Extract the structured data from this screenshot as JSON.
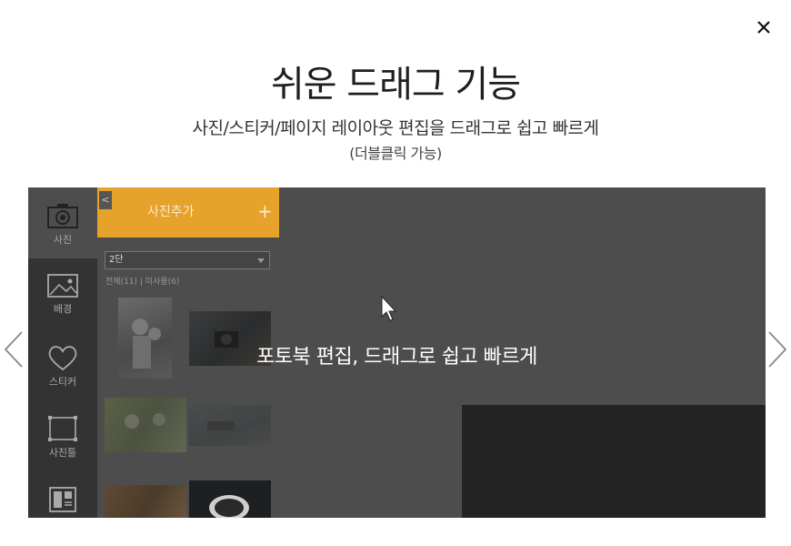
{
  "dialog": {
    "title": "쉬운 드래그 기능",
    "subtitle": "사진/스티커/페이지 레이아웃 편집을 드래그로 쉽고 빠르게",
    "subnote": "(더블클릭 가능)",
    "close_icon": "close-icon",
    "prev_icon": "chevron-left-icon",
    "next_icon": "chevron-right-icon"
  },
  "preview": {
    "overlay_text": "포토북 편집, 드래그로 쉽고 빠르게",
    "tools": [
      {
        "label": "사진",
        "icon": "camera-icon"
      },
      {
        "label": "배경",
        "icon": "image-icon"
      },
      {
        "label": "스티커",
        "icon": "heart-icon"
      },
      {
        "label": "사진틀",
        "icon": "frame-icon"
      },
      {
        "label": "",
        "icon": "layout-icon"
      }
    ],
    "panel": {
      "collapse_label": "<",
      "add_photo_label": "사진추가",
      "add_plus": "+",
      "column_select": "2단",
      "count_text": "전체(11) | 미사용(6)"
    },
    "colors": {
      "accent": "#e6a22a",
      "overlay_bg": "#4d4d4d",
      "sidebar_bg": "#333333"
    }
  }
}
